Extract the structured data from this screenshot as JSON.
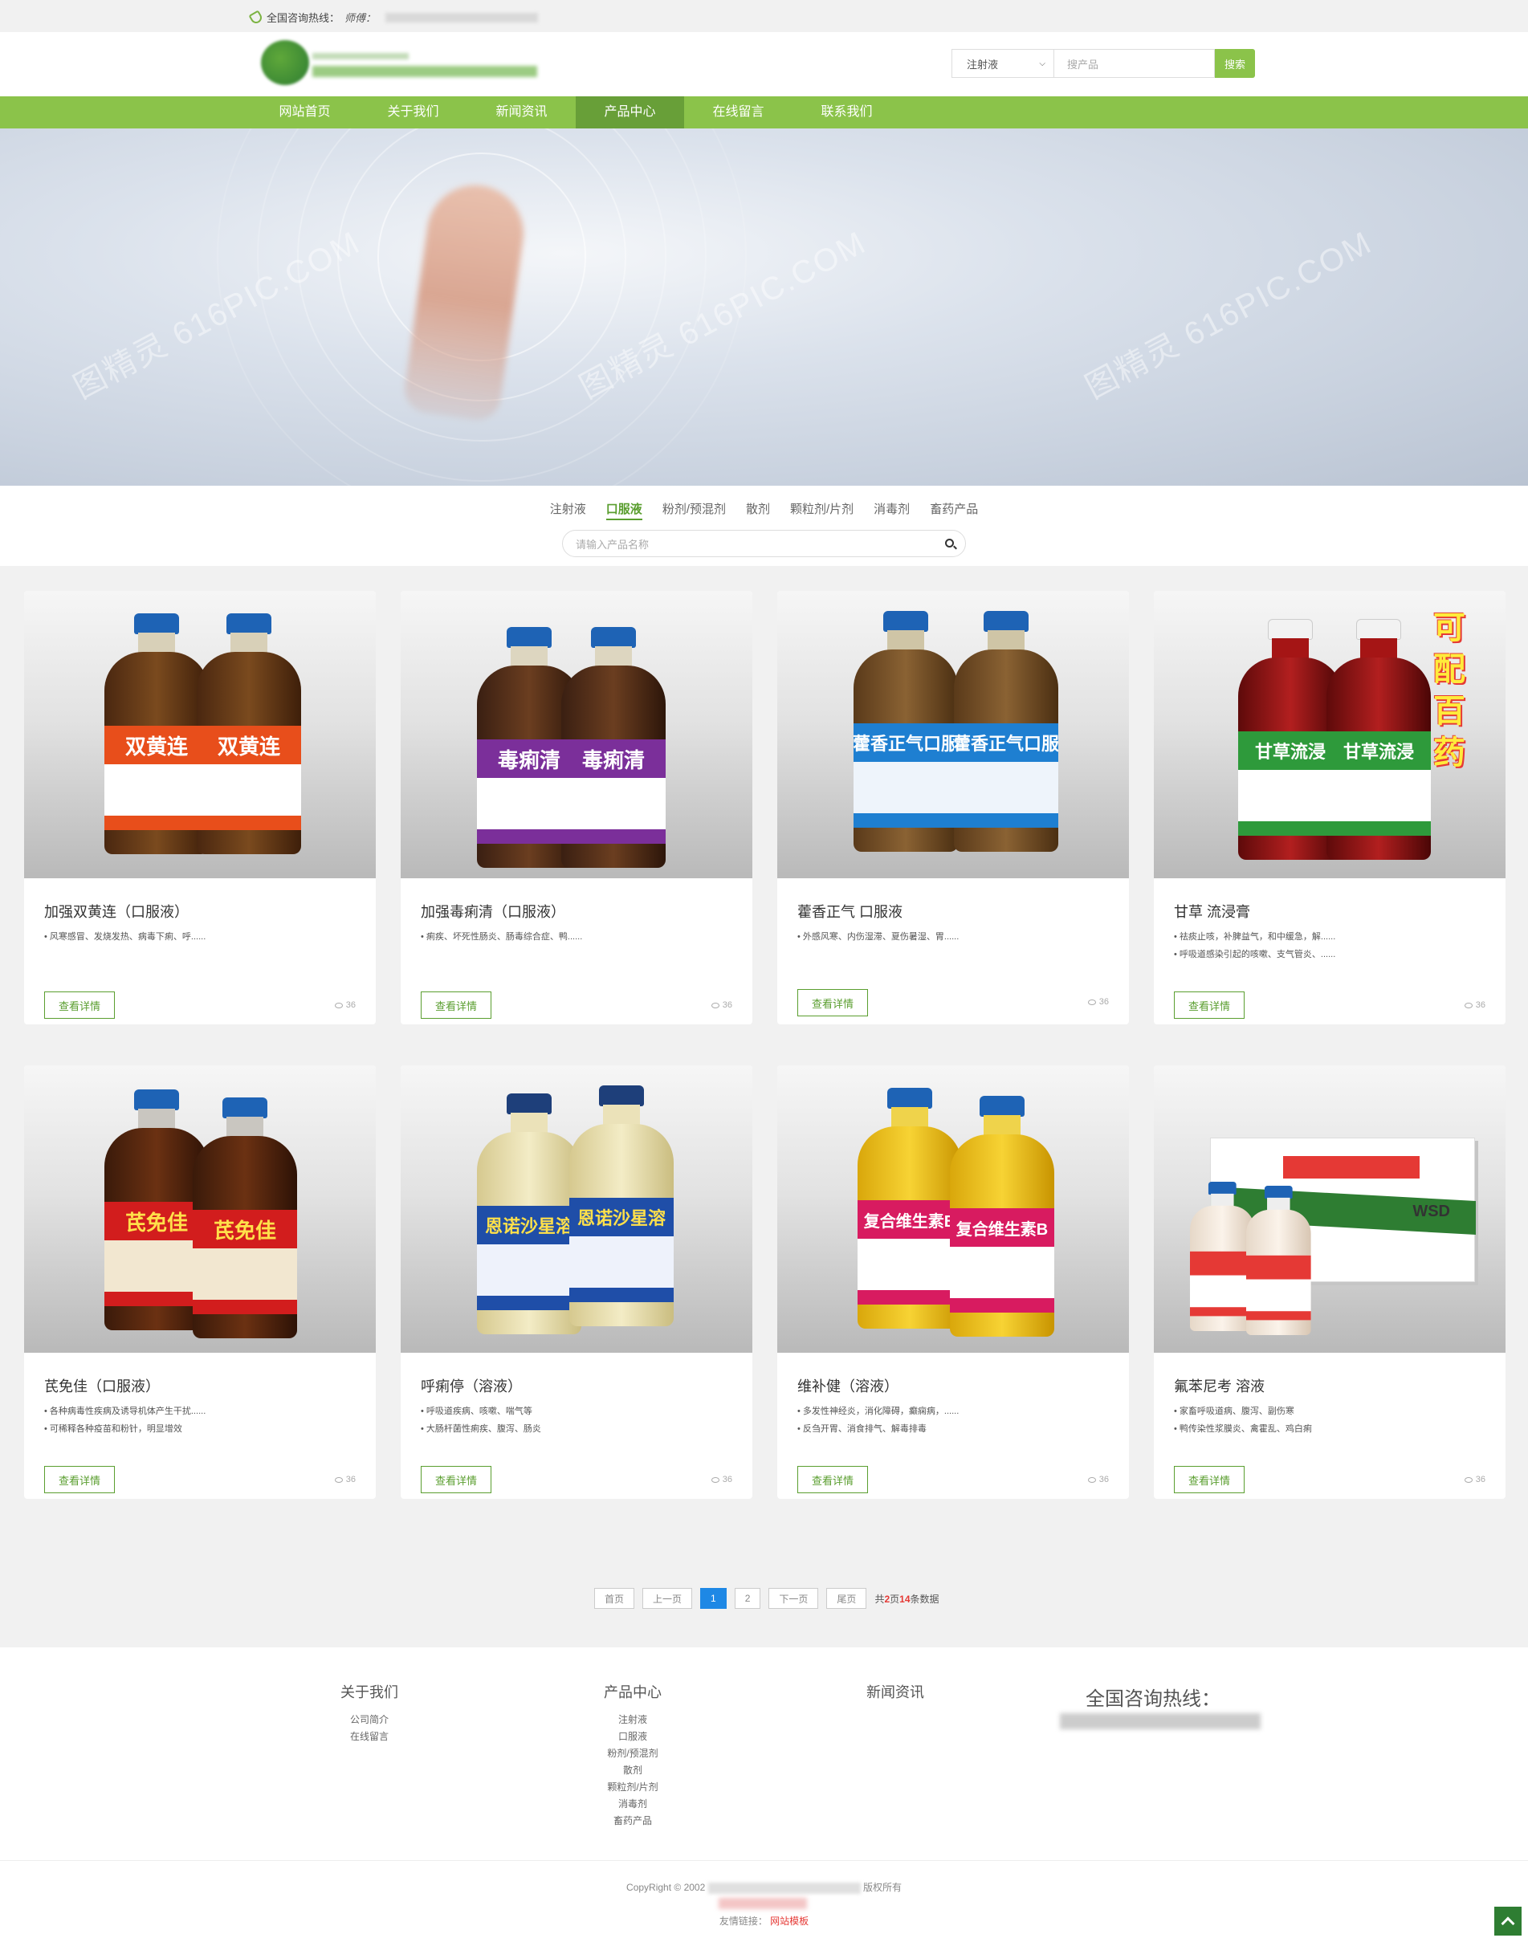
{
  "topbar": {
    "hotline_label": "全国咨询热线：",
    "contact_prefix": "师傅："
  },
  "search": {
    "category": "注射液",
    "placeholder": "搜产品",
    "button": "搜索"
  },
  "nav": [
    "网站首页",
    "关于我们",
    "新闻资讯",
    "产品中心",
    "在线留言",
    "联系我们"
  ],
  "nav_active": "产品中心",
  "banner": {
    "watermark": "图精灵 616PIC.COM"
  },
  "categories": [
    "注射液",
    "口服液",
    "粉剂/预混剂",
    "散剂",
    "颗粒剂/片剂",
    "消毒剂",
    "畜药产品"
  ],
  "category_active": "口服液",
  "product_search": {
    "placeholder": "请输入产品名称"
  },
  "products": [
    {
      "title": "加强双黄连（口服液）",
      "desc": [
        "风寒感冒、发烧发热、病毒下痢、呼......"
      ],
      "more": "查看详情",
      "views": "36"
    },
    {
      "title": "加强毒痢清（口服液）",
      "desc": [
        "痢疾、坏死性肠炎、肠毒综合症、鸭......"
      ],
      "more": "查看详情",
      "views": "36"
    },
    {
      "title": "藿香正气 口服液",
      "desc": [
        "外感风寒、内伤湿滞、夏伤暑湿、胃......"
      ],
      "more": "查看详情",
      "views": "36"
    },
    {
      "title": "甘草 流浸膏",
      "desc": [
        "祛痰止咳，补脾益气，和中缓急，解......",
        "呼吸道感染引起的咳嗽、支气管炎、......"
      ],
      "more": "查看详情",
      "views": "36"
    },
    {
      "title": "芪免佳（口服液）",
      "desc": [
        "各种病毒性疾病及诱导机体产生干扰......",
        "可稀释各种疫苗和粉针，明显增效"
      ],
      "more": "查看详情",
      "views": "36"
    },
    {
      "title": "呼痢停（溶液）",
      "desc": [
        "呼吸道疾病、咳嗽、喘气等",
        "大肠杆菌性痢疾、腹泻、肠炎"
      ],
      "more": "查看详情",
      "views": "36"
    },
    {
      "title": "维补健（溶液）",
      "desc": [
        "多发性神经炎，消化障碍，癫痫病，......",
        "反刍开胃、消食排气、解毒排毒"
      ],
      "more": "查看详情",
      "views": "36"
    },
    {
      "title": "氟苯尼考 溶液",
      "desc": [
        "家畜呼吸道病、腹泻、副伤寒",
        "鸭传染性浆膜炎、禽霍乱、鸡白痢"
      ],
      "more": "查看详情",
      "views": "36"
    }
  ],
  "bottle_labels": [
    "双黄连",
    "毒痢清",
    "藿香正气口服",
    "甘草流浸",
    "芪免佳",
    "恩诺沙星溶",
    "复合维生素B",
    ""
  ],
  "product_badge": "可配百药",
  "box_brand": "WSD",
  "pager": {
    "first": "首页",
    "prev": "上一页",
    "pages": [
      "1",
      "2"
    ],
    "current": "1",
    "next": "下一页",
    "last": "尾页",
    "info_prefix": "共",
    "total_pages": "2",
    "info_mid": "页",
    "total_items": "14",
    "info_suffix": "条数据"
  },
  "footer": {
    "col1": {
      "title": "关于我们",
      "items": [
        "公司简介",
        "在线留言"
      ]
    },
    "col2": {
      "title": "产品中心",
      "items": [
        "注射液",
        "口服液",
        "粉剂/预混剂",
        "散剂",
        "颗粒剂/片剂",
        "消毒剂",
        "畜药产品"
      ]
    },
    "col3": {
      "title": "新闻资讯",
      "items": []
    },
    "hotline": "全国咨询热线："
  },
  "bottom": {
    "copyright_prefix": "CopyRight © 2002",
    "copyright_suffix": "版权所有",
    "links_label": "友情链接：",
    "link1": "网站模板"
  },
  "colors": {
    "accent": "#8bc34a",
    "accent_dark": "#689f38",
    "button_green": "#5a9e2f",
    "page_current": "#1e88e5"
  }
}
